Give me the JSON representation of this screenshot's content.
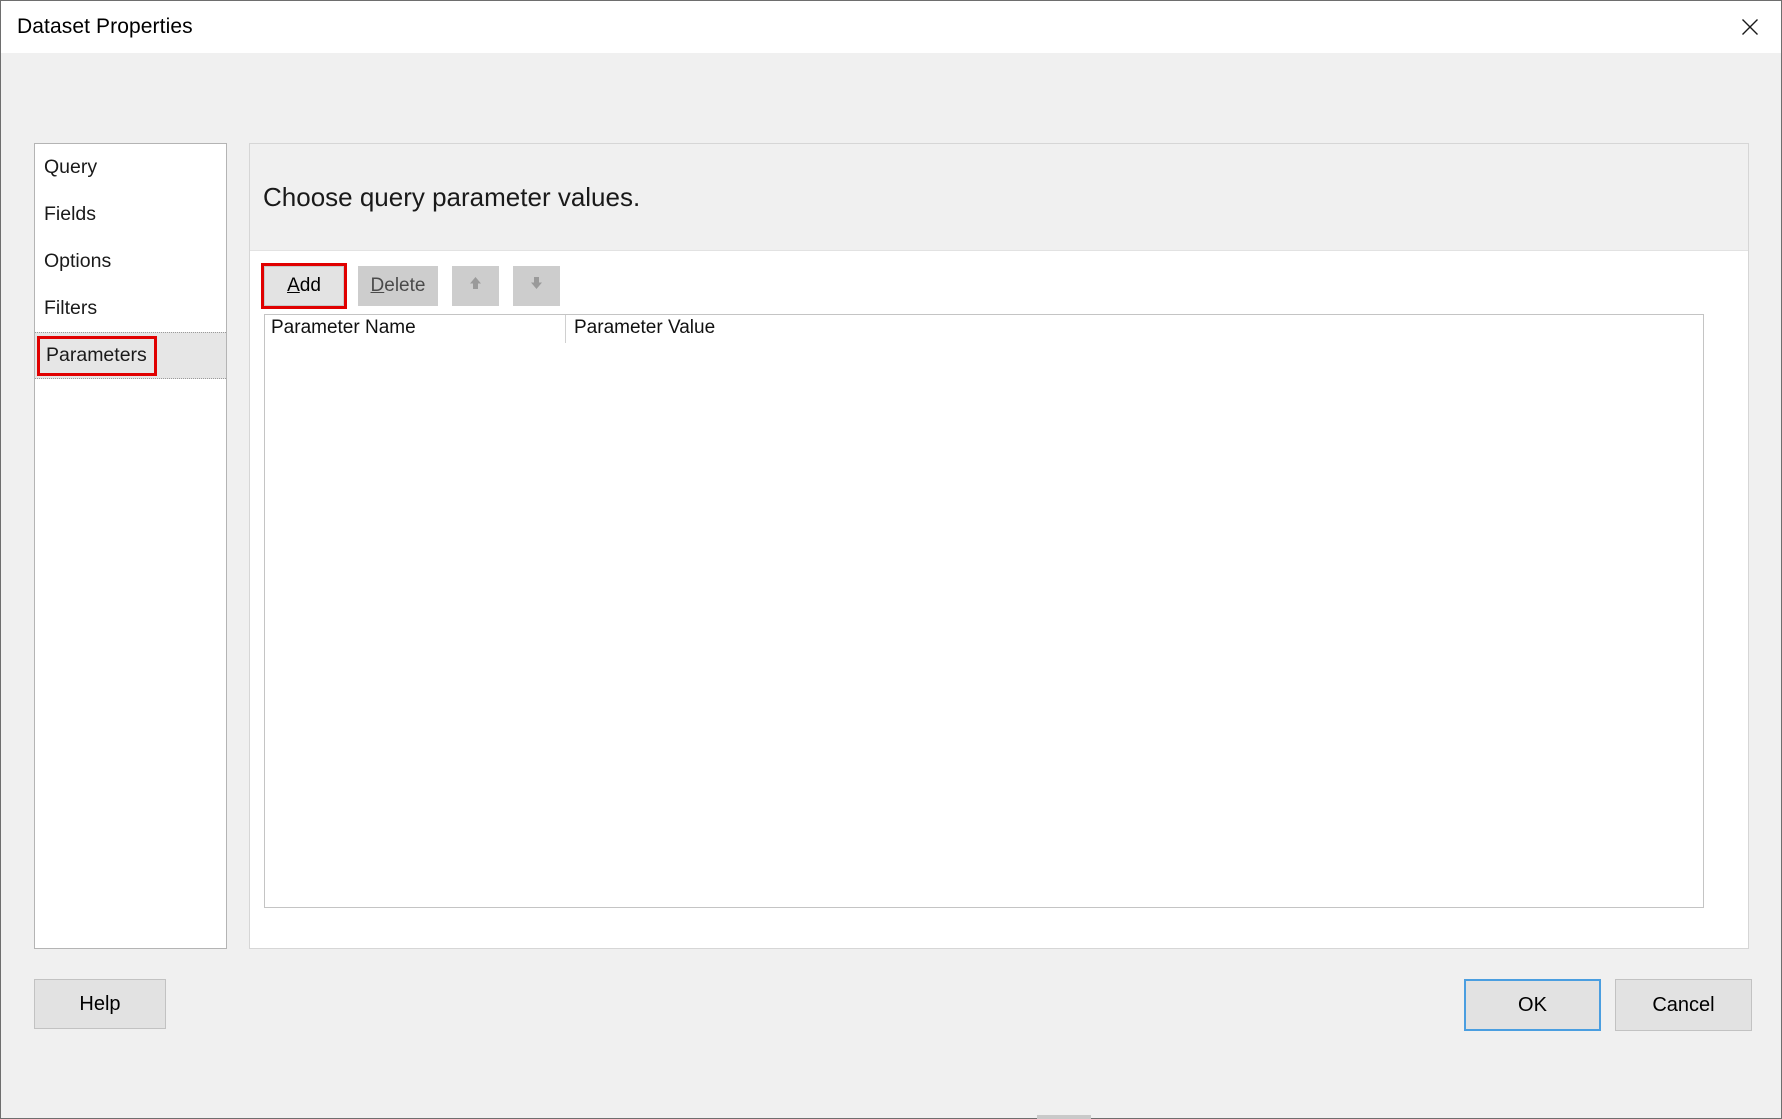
{
  "window": {
    "title": "Dataset Properties",
    "close_icon": "close-icon"
  },
  "sidebar": {
    "items": [
      {
        "label": "Query",
        "selected": false
      },
      {
        "label": "Fields",
        "selected": false
      },
      {
        "label": "Options",
        "selected": false
      },
      {
        "label": "Filters",
        "selected": false
      },
      {
        "label": "Parameters",
        "selected": true
      }
    ]
  },
  "main": {
    "heading": "Choose query parameter values.",
    "toolbar": {
      "add_label": "Add",
      "add_accel": "A",
      "add_rest": "dd",
      "delete_label": "Delete",
      "delete_accel": "D",
      "delete_rest": "elete",
      "move_up_icon": "arrow-up-icon",
      "move_down_icon": "arrow-down-icon"
    },
    "grid": {
      "columns": [
        "Parameter Name",
        "Parameter Value"
      ],
      "rows": []
    }
  },
  "footer": {
    "help_label": "Help",
    "ok_label": "OK",
    "cancel_label": "Cancel"
  },
  "colors": {
    "highlight": "#e00000",
    "focus": "#4a9ee0",
    "dialog_bg": "#f0f0f0",
    "panel_bg": "#ffffff"
  }
}
